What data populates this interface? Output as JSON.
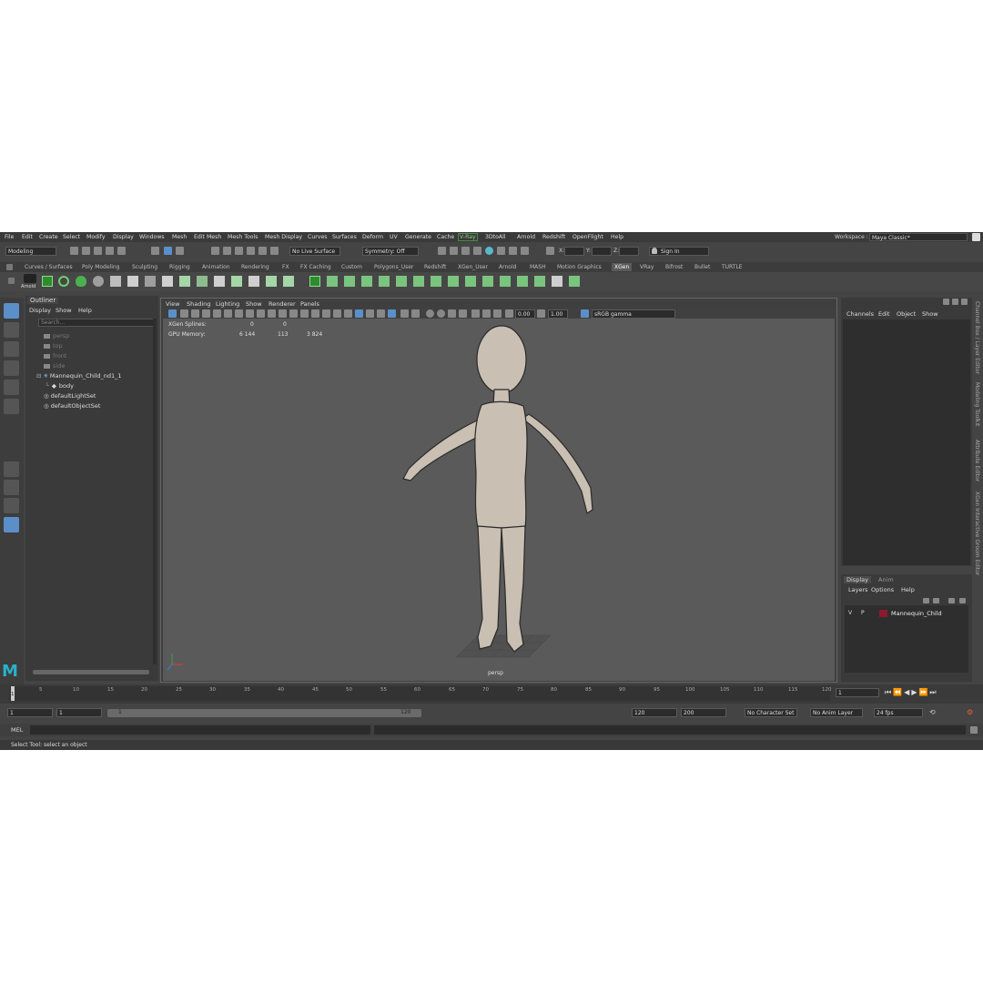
{
  "menubar": {
    "items": [
      "File",
      "Edit",
      "Create",
      "Select",
      "Modify",
      "Display",
      "Windows",
      "Mesh",
      "Edit Mesh",
      "Mesh Tools",
      "Mesh Display",
      "Curves",
      "Surfaces",
      "Deform",
      "UV",
      "Generate",
      "Cache",
      "V-Ray",
      "3DtoAll",
      "Arnold",
      "Redshift",
      "OpenFlight",
      "Help"
    ],
    "workspace_label": "Workspace :",
    "workspace_value": "Maya Classic*"
  },
  "toolbar": {
    "mode": "Modeling",
    "live_surface": "No Live Surface",
    "symmetry": "Symmetry: Off",
    "x_label": "X:",
    "y_label": "Y:",
    "z_label": "Z:",
    "sign_in": "Sign In"
  },
  "shelf_tabs": [
    "Curves / Surfaces",
    "Poly Modeling",
    "Sculpting",
    "Rigging",
    "Animation",
    "Rendering",
    "FX",
    "FX Caching",
    "Custom",
    "Polygons_User",
    "Redshift",
    "XGen_User",
    "Arnold",
    "MASH",
    "Motion Graphics",
    "XGen",
    "VRay",
    "Bifrost",
    "Bullet",
    "TURTLE"
  ],
  "shelf_active": "XGen",
  "shelf_first_label": "Arnold",
  "outliner": {
    "title": "Outliner",
    "menu": [
      "Display",
      "Show",
      "Help"
    ],
    "search_placeholder": "Search...",
    "nodes": [
      "persp",
      "top",
      "front",
      "side",
      "Mannequin_Child_nd1_1",
      "body",
      "defaultLightSet",
      "defaultObjectSet"
    ]
  },
  "viewport": {
    "menu": [
      "View",
      "Shading",
      "Lighting",
      "Show",
      "Renderer",
      "Panels"
    ],
    "exposure": "0.00",
    "gamma": "1.00",
    "colorspace": "sRGB gamma",
    "hud": {
      "rows": [
        {
          "label": "XGen Splines:",
          "values": [
            "0",
            "0"
          ]
        },
        {
          "label": "GPU Memory:",
          "values": [
            "6 144",
            "113",
            "3 824"
          ]
        }
      ]
    },
    "camera_label": "persp"
  },
  "channel_box": {
    "menu": [
      "Channels",
      "Edit",
      "Object",
      "Show"
    ]
  },
  "layer_editor": {
    "tabs": [
      "Display",
      "Anim"
    ],
    "menu": [
      "Layers",
      "Options",
      "Help"
    ],
    "layer": {
      "v": "V",
      "p": "P",
      "name": "Mannequin_Child",
      "color": "#8b1a2b"
    }
  },
  "side_tabs": [
    "Channel Box / Layer Editor",
    "Modeling Toolkit",
    "Attribute Editor",
    "XGen Interactive Groom Editor"
  ],
  "timeline": {
    "ticks": [
      "5",
      "10",
      "15",
      "20",
      "25",
      "30",
      "35",
      "40",
      "45",
      "50",
      "55",
      "60",
      "65",
      "70",
      "75",
      "80",
      "85",
      "90",
      "95",
      "100",
      "105",
      "110",
      "115",
      "120"
    ],
    "current_frame": "1",
    "current_frame_field": "1"
  },
  "range": {
    "start": "1",
    "start2": "1",
    "slider_start": "1",
    "slider_end": "120",
    "end": "120",
    "end2": "200",
    "character_set": "No Character Set",
    "anim_layer": "No Anim Layer",
    "fps": "24 fps"
  },
  "cmdline": {
    "label": "MEL"
  },
  "helpline": {
    "text": "Select Tool: select an object"
  },
  "colors": {
    "accent": "#5b8fc9",
    "vray_green": "#7fd37f",
    "mesh": "#c9bfb2"
  }
}
